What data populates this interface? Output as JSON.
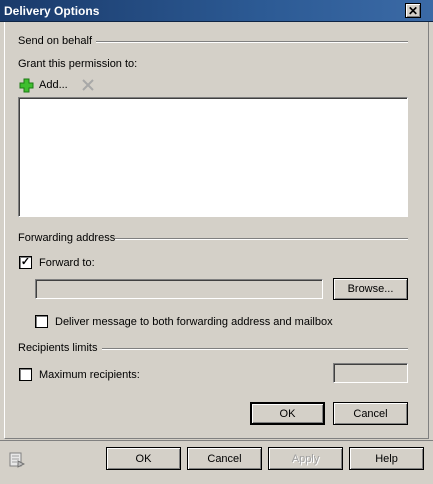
{
  "window": {
    "title": "Delivery Options"
  },
  "send_on_behalf": {
    "header": "Send on behalf",
    "grant_label": "Grant this permission to:",
    "add_label": "Add...",
    "items": []
  },
  "forwarding": {
    "header": "Forwarding address",
    "forward_to_label": "Forward to:",
    "forward_to_checked": true,
    "forward_to_value": "",
    "browse_label": "Browse...",
    "deliver_both_label": "Deliver message to both forwarding address and mailbox",
    "deliver_both_checked": false
  },
  "recipients_limits": {
    "header": "Recipients limits",
    "max_label": "Maximum recipients:",
    "max_checked": false,
    "max_value": ""
  },
  "dialog_buttons": {
    "ok": "OK",
    "cancel": "Cancel"
  },
  "parent_buttons": {
    "ok": "OK",
    "cancel": "Cancel",
    "apply": "Apply",
    "help": "Help"
  },
  "check_mark": "✓"
}
